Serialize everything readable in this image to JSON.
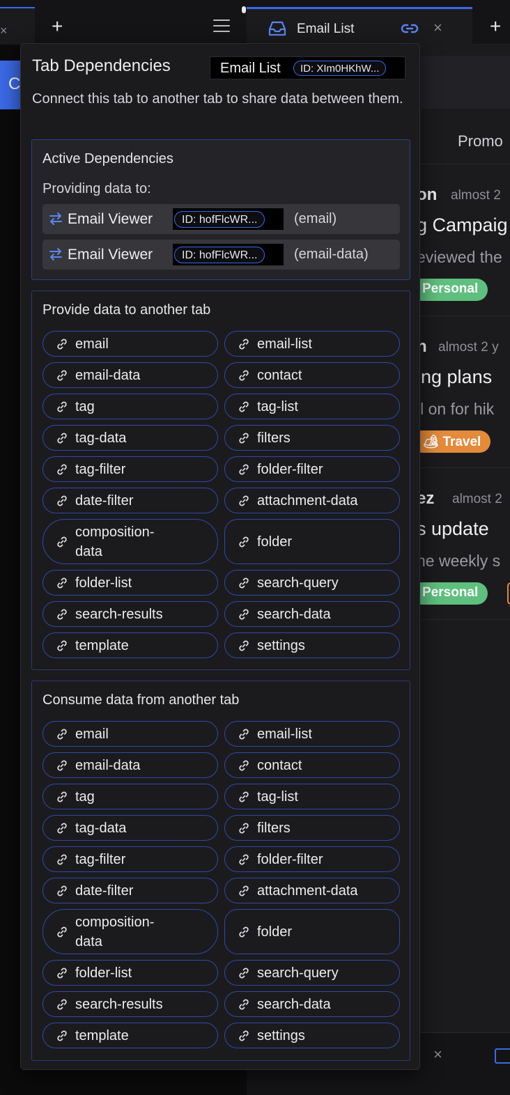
{
  "tabs": {
    "left_close": "×",
    "add_label": "+",
    "active_tab_title": "Email List",
    "active_tab_close": "×",
    "right_add_label": "+"
  },
  "background": {
    "left_button_text": "C",
    "category_tab": "Promo",
    "emails": [
      {
        "sender": "on",
        "time": "almost 2",
        "subject": "g Campaig",
        "preview": "eviewed the",
        "tag": "Personal",
        "tag_color": "#5fbf7e"
      },
      {
        "sender": "n",
        "time": "almost 2 y",
        "subject": "ing plans",
        "preview": "ll on for hik",
        "tag": "🏕 Travel",
        "tag_color": "#e38a3b"
      },
      {
        "sender": "ez",
        "time": "almost 2",
        "subject": "s update",
        "preview": "he weekly s",
        "tag": "Personal",
        "tag_color": "#5fbf7e"
      }
    ],
    "bottom_close": "×"
  },
  "popover": {
    "title": "Tab Dependencies",
    "tab_name": "Email List",
    "tab_id": "ID: XIm0HKhW...",
    "description": "Connect this tab to another tab to share data between them.",
    "active": {
      "title": "Active Dependencies",
      "providing_label": "Providing data to:",
      "rows": [
        {
          "name": "Email Viewer",
          "id": "ID: hofFlcWR...",
          "key": "(email)"
        },
        {
          "name": "Email Viewer",
          "id": "ID: hofFlcWR...",
          "key": "(email-data)"
        }
      ]
    },
    "provide": {
      "title": "Provide data to another tab",
      "items": [
        "email",
        "email-list",
        "email-data",
        "contact",
        "tag",
        "tag-list",
        "tag-data",
        "filters",
        "tag-filter",
        "folder-filter",
        "date-filter",
        "attachment-data",
        "composition-data",
        "folder",
        "folder-list",
        "search-query",
        "search-results",
        "search-data",
        "template",
        "settings"
      ]
    },
    "consume": {
      "title": "Consume data from another tab",
      "items": [
        "email",
        "email-list",
        "email-data",
        "contact",
        "tag",
        "tag-list",
        "tag-data",
        "filters",
        "tag-filter",
        "folder-filter",
        "date-filter",
        "attachment-data",
        "composition-data",
        "folder",
        "folder-list",
        "search-query",
        "search-results",
        "search-data",
        "template",
        "settings"
      ]
    }
  },
  "colors": {
    "accent": "#3b6ae6",
    "panel": "#1b1b1e",
    "pill_border": "#2f49a8"
  }
}
